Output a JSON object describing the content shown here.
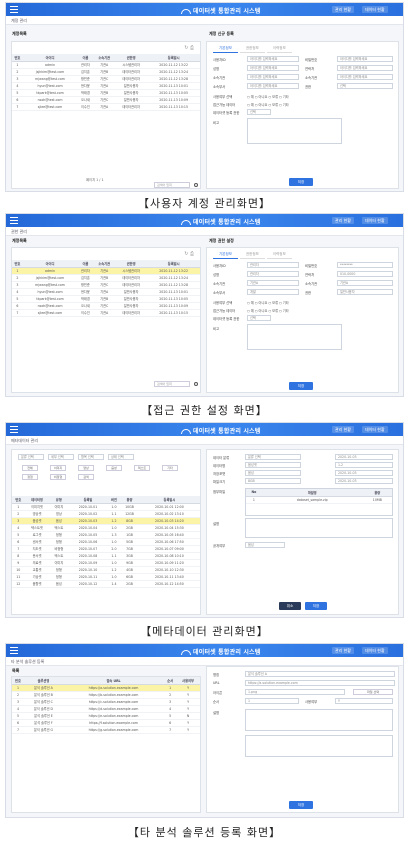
{
  "brand": "데이터셋 통합관리 시스템",
  "top_buttons": [
    "관리 현황",
    "데이터 현황"
  ],
  "captions": [
    "【사용자 계정 관리화면】",
    "【접근 권한 설정 화면】",
    "【메타데이터 관리화면】",
    "【타 분석 솔루션 등록 화면】"
  ],
  "s1": {
    "crumb": "계정 관리",
    "list_title": "계정목록",
    "detail_title": "계정 신규 등록",
    "columns": [
      "번호",
      "아이디",
      "이름",
      "소속기관",
      "권한명",
      "등록일시"
    ],
    "rows": [
      [
        "1",
        "admin",
        "관리자",
        "기관A",
        "시스템관리자",
        "2020-11-12 13:22"
      ],
      [
        "2",
        "jsjhkim@test.com",
        "김지훈",
        "기관B",
        "데이터관리자",
        "2020-11-12 13:24"
      ],
      [
        "3",
        "mjwang@test.com",
        "왕민준",
        "기관C",
        "데이터관리자",
        "2020-11-12 13:28"
      ],
      [
        "4",
        "hyun@test.com",
        "현다윤",
        "기관A",
        "일반사용자",
        "2020-11-13 10:01"
      ],
      [
        "5",
        "tkpark@test.com",
        "박태경",
        "기관B",
        "일반사용자",
        "2020-11-13 10:05"
      ],
      [
        "6",
        "nsoh@test.com",
        "오나새",
        "기관C",
        "일반사용자",
        "2020-11-13 10:09"
      ],
      [
        "7",
        "sjlee@test.com",
        "이수진",
        "기관A",
        "데이터관리자",
        "2020-11-13 10:15"
      ]
    ],
    "tabs": [
      "기본정보",
      "권한정보",
      "이력정보"
    ],
    "fields_left": [
      "사용자ID",
      "성명",
      "소속기관",
      "소속부서"
    ],
    "fields_right": [
      "비밀번호",
      "연락처",
      "소속기관",
      "권한"
    ],
    "placeholder": "아이디를 입력하세요",
    "select_default": "선택",
    "extra_rows": [
      "사용여부 선택",
      "접근가능 데이터",
      "데이터셋 등록 권한",
      "비고"
    ],
    "radio_text": "○ 예   ○ 아니요   ○ 보류   ○ 기타",
    "save": "저장",
    "pager": "페이지 1 / 1",
    "search": "검색어 입력"
  },
  "s2": {
    "crumb": "권한 관리",
    "list_title": "계정목록",
    "detail_title": "계정 권한 설정",
    "tabs": [
      "기본정보",
      "권한정보",
      "이력정보"
    ],
    "values_left": [
      "관리자",
      "관리자",
      "기관A",
      "개발"
    ],
    "values_right": [
      "********",
      "010-0000",
      "기관A",
      "일반사용자"
    ],
    "extra_rows": [
      "사용여부 선택",
      "접근가능 데이터",
      "데이터셋 등록 권한",
      "비고"
    ],
    "save": "저장"
  },
  "s3": {
    "crumb": "메타데이터 관리",
    "filters": [
      "분류 선택",
      "세부 선택",
      "항목 선택",
      "상태 선택"
    ],
    "chips": [
      "전체",
      "이미지",
      "영상",
      "음성",
      "텍스트",
      "기타",
      "정형",
      "비정형",
      "검색"
    ],
    "columns": [
      "번호",
      "데이터명",
      "유형",
      "등록일",
      "버전",
      "용량",
      "등록일시"
    ],
    "rows": [
      [
        "1",
        "이미지셋",
        "이미지",
        "2020-10-01",
        "1.0",
        "10GB",
        "2020-10-01 12:00"
      ],
      [
        "2",
        "영상셋",
        "영상",
        "2020-10-02",
        "1.1",
        "12GB",
        "2020-10-02 13:10"
      ],
      [
        "3",
        "음성셋",
        "음성",
        "2020-10-03",
        "1.2",
        "8GB",
        "2020-10-03 14:20"
      ],
      [
        "4",
        "텍스트셋",
        "텍스트",
        "2020-10-04",
        "1.0",
        "2GB",
        "2020-10-04 15:30"
      ],
      [
        "5",
        "로그셋",
        "정형",
        "2020-10-05",
        "1.3",
        "1GB",
        "2020-10-05 16:40"
      ],
      [
        "6",
        "센서셋",
        "정형",
        "2020-10-06",
        "1.0",
        "5GB",
        "2020-10-06 17:50"
      ],
      [
        "7",
        "지도셋",
        "비정형",
        "2020-10-07",
        "2.0",
        "7GB",
        "2020-10-07 09:00"
      ],
      [
        "8",
        "문서셋",
        "텍스트",
        "2020-10-08",
        "1.1",
        "3GB",
        "2020-10-08 10:10"
      ],
      [
        "9",
        "의료셋",
        "이미지",
        "2020-10-09",
        "1.0",
        "9GB",
        "2020-10-09 11:20"
      ],
      [
        "10",
        "교통셋",
        "정형",
        "2020-10-10",
        "1.2",
        "4GB",
        "2020-10-10 12:30"
      ],
      [
        "11",
        "기상셋",
        "정형",
        "2020-10-11",
        "1.0",
        "6GB",
        "2020-10-11 13:40"
      ],
      [
        "12",
        "음향셋",
        "음성",
        "2020-10-12",
        "1.4",
        "2GB",
        "2020-10-12 14:50"
      ]
    ],
    "selected_row": 2,
    "form_labels": [
      "데이터 분류",
      "데이터명",
      "저장포맷",
      "파일크기",
      "첨부파일",
      "설명",
      "공개여부"
    ],
    "file_columns": [
      "No",
      "파일명",
      "용량"
    ],
    "file_row": [
      "1",
      "dataset_sample.zip",
      "10MB"
    ],
    "save": "저장",
    "cancel": "취소"
  },
  "s4": {
    "crumb": "타 분석 솔루션 등록",
    "list_title": "목록",
    "columns": [
      "번호",
      "솔루션명",
      "접속 URL",
      "순서",
      "사용여부"
    ],
    "rows": [
      [
        "1",
        "분석 솔루션 A",
        "https://a-solution.example.com",
        "1",
        "Y"
      ],
      [
        "2",
        "분석 솔루션 B",
        "https://b-solution.example.com",
        "2",
        "Y"
      ],
      [
        "3",
        "분석 솔루션 C",
        "https://c-solution.example.com",
        "3",
        "Y"
      ],
      [
        "4",
        "분석 솔루션 D",
        "https://d-solution.example.com",
        "4",
        "Y"
      ],
      [
        "5",
        "분석 솔루션 E",
        "https://e-solution.example.com",
        "5",
        "N"
      ],
      [
        "6",
        "분석 솔루션 F",
        "https://f-solution.example.com",
        "6",
        "Y"
      ],
      [
        "7",
        "분석 솔루션 G",
        "https://g-solution.example.com",
        "7",
        "Y"
      ]
    ],
    "selected_row": 0,
    "form_labels": [
      "명칭",
      "URL",
      "아이콘",
      "순서",
      "사용여부",
      "설명"
    ],
    "form_values": [
      "분석 솔루션 A",
      "https://a-solution.example.com",
      "1.png",
      "1",
      "Y"
    ],
    "upload": "파일 선택",
    "save": "저장"
  }
}
